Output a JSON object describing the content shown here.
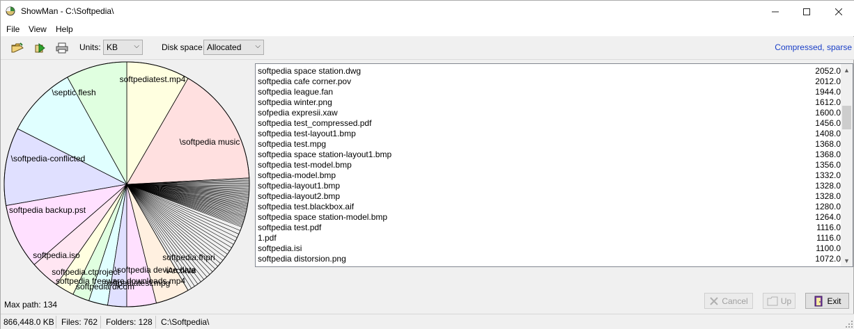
{
  "window": {
    "title": "ShowMan - C:\\Softpedia\\",
    "min_icon": "minimize-icon",
    "max_icon": "maximize-icon",
    "close_icon": "close-icon"
  },
  "menu": [
    "File",
    "View",
    "Help"
  ],
  "toolbar": {
    "units_label": "Units:",
    "units_value": "KB",
    "disk_label": "Disk space:",
    "disk_value": "Allocated",
    "status_right": "Compressed, sparse"
  },
  "pie": {
    "labels": [
      "\\softpedia music",
      "softpediatest.mp4",
      "\\septic flesh",
      "\\softpedia-conflicted",
      "softpedia backup.pst",
      "softpedia.iso",
      "softpedia.ctproject",
      "softpedia freeware downloads.mp4",
      "softpedia dicom",
      "\\softpedia device data",
      "softpediatest.mpg",
      "\\Archive",
      "softpedia.fhpri"
    ],
    "colors": [
      "#ffe0e0",
      "#ffffe0",
      "#e0ffe0",
      "#e0ffff",
      "#e0e0ff",
      "#ffe0ff",
      "#ffe6f2",
      "#ffffe0",
      "#e0ffe0",
      "#e0ffff",
      "#e0e0ff",
      "#ffe0ff",
      "#fff0e0"
    ]
  },
  "max_path": "Max path: 134",
  "files": [
    {
      "name": "softpedia space station.dwg",
      "size": "2052.0"
    },
    {
      "name": "softpedia cafe corner.pov",
      "size": "2012.0"
    },
    {
      "name": "softpedia league.fan",
      "size": "1944.0"
    },
    {
      "name": "softpedia winter.png",
      "size": "1612.0"
    },
    {
      "name": "sofpedia expresii.xaw",
      "size": "1600.0"
    },
    {
      "name": "softpedia test_compressed.pdf",
      "size": "1456.0"
    },
    {
      "name": "softpedia test-layout1.bmp",
      "size": "1408.0"
    },
    {
      "name": "softpedia test.mpg",
      "size": "1368.0"
    },
    {
      "name": "softpedia space station-layout1.bmp",
      "size": "1368.0"
    },
    {
      "name": "softpedia test-model.bmp",
      "size": "1356.0"
    },
    {
      "name": "softpedia-model.bmp",
      "size": "1332.0"
    },
    {
      "name": "softpedia-layout1.bmp",
      "size": "1328.0"
    },
    {
      "name": "softpedia-layout2.bmp",
      "size": "1328.0"
    },
    {
      "name": "softpedia test.blackbox.aif",
      "size": "1280.0"
    },
    {
      "name": "softpedia space station-model.bmp",
      "size": "1264.0"
    },
    {
      "name": "softpedia test.pdf",
      "size": "1116.0"
    },
    {
      "name": "1.pdf",
      "size": "1116.0"
    },
    {
      "name": "softpedia.isi",
      "size": "1100.0"
    },
    {
      "name": "softpedia distorsion.png",
      "size": "1072.0"
    }
  ],
  "buttons": {
    "cancel": "Cancel",
    "up": "Up",
    "exit": "Exit"
  },
  "status": {
    "size": "866,448.0 KB",
    "files": "Files: 762",
    "folders": "Folders: 128",
    "path": "C:\\Softpedia\\"
  }
}
